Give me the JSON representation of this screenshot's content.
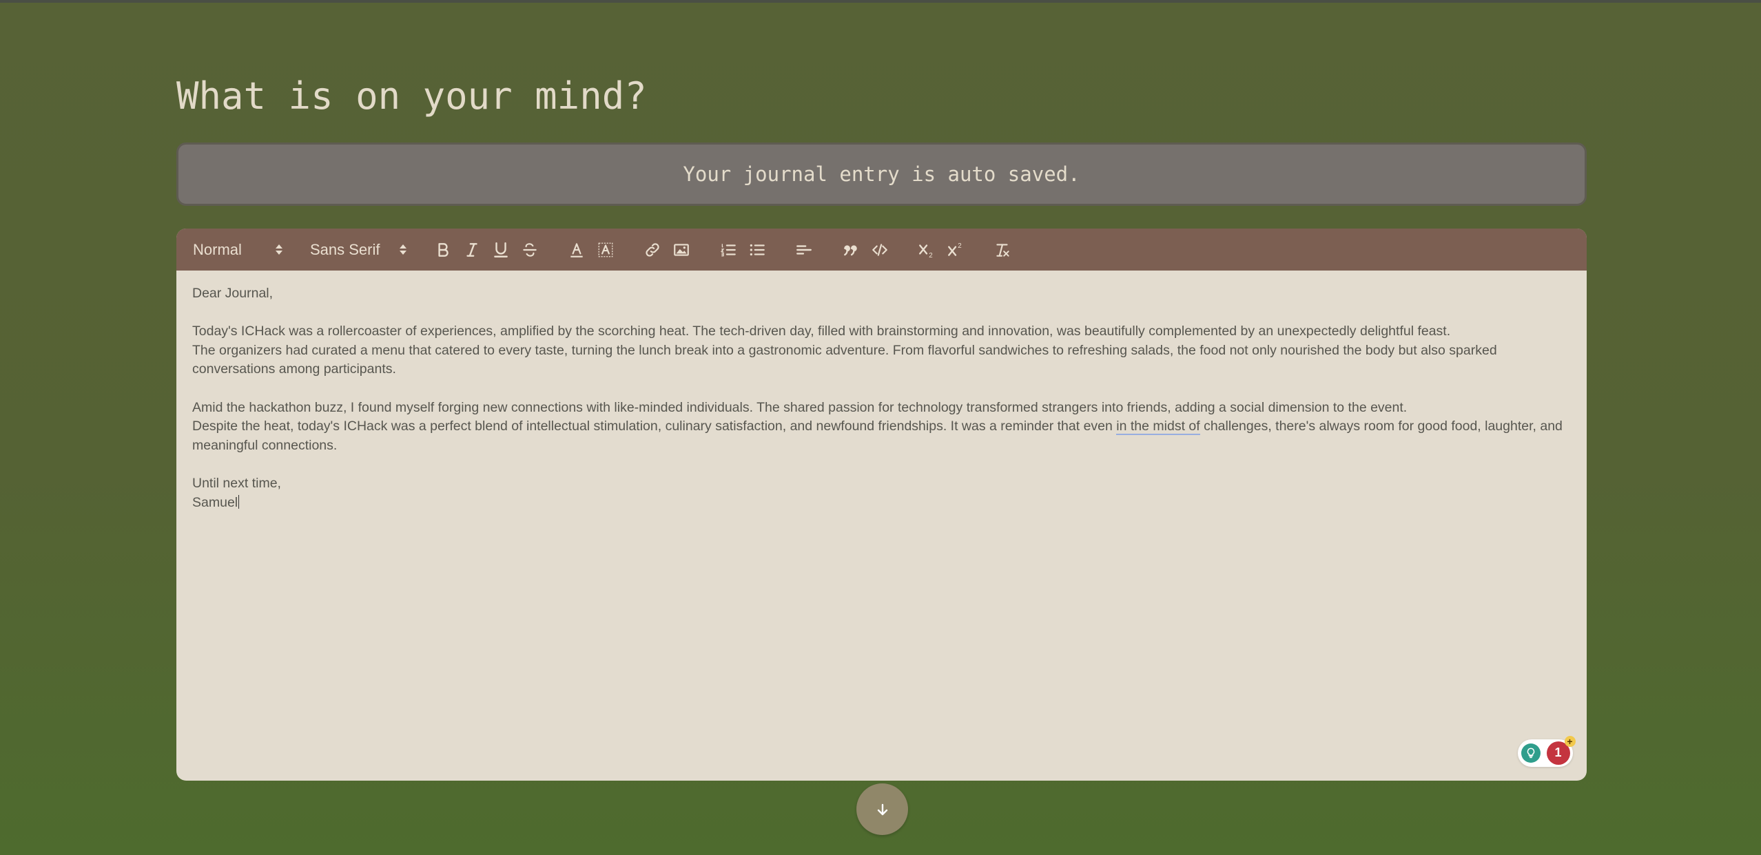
{
  "page": {
    "title": "What is on your mind?",
    "autosave_notice": "Your journal entry is auto saved."
  },
  "toolbar": {
    "header_picker": "Normal",
    "font_picker": "Sans Serif",
    "buttons": [
      "bold",
      "italic",
      "underline",
      "strike",
      "text-color",
      "background-color",
      "link",
      "image",
      "ordered-list",
      "bullet-list",
      "align",
      "blockquote",
      "code-block",
      "subscript",
      "superscript",
      "clean-formatting"
    ]
  },
  "entry": {
    "greeting": "Dear Journal,",
    "para1_line1": "Today's ICHack was a rollercoaster of experiences, amplified by the scorching heat. The tech-driven day, filled with brainstorming and innovation, was beautifully complemented by an unexpectedly delightful feast.",
    "para1_line2": "The organizers had curated a menu that catered to every taste, turning the lunch break into a gastronomic adventure. From flavorful sandwiches to refreshing salads, the food not only nourished the body but also sparked conversations among participants.",
    "para2_line1": "Amid the hackathon buzz, I found myself forging new connections with like-minded individuals. The shared passion for technology transformed strangers into friends, adding a social dimension to the event.",
    "para2_line2_before": "Despite the heat, today's ICHack was a perfect blend of intellectual stimulation, culinary satisfaction, and newfound friendships. It was a reminder that even ",
    "para2_line2_flagged": "in the midst of",
    "para2_line2_after": " challenges, there's always room for good food, laughter, and meaningful connections.",
    "signoff": "Until next time,",
    "signature": "Samuel"
  },
  "grammar_widget": {
    "issue_count": "1",
    "plus": "+"
  },
  "colors": {
    "background": "#556234",
    "toolbar": "#7c5f52",
    "editor": "#e3dccf",
    "banner": "#76716d",
    "scroll_button": "#908769"
  }
}
